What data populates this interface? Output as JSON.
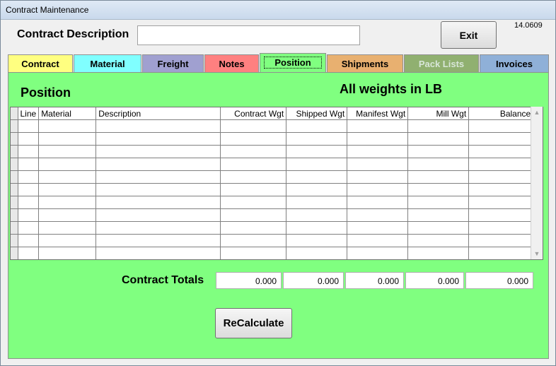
{
  "window": {
    "title": "Contract Maintenance",
    "version": "14.0609"
  },
  "header": {
    "description_label": "Contract Description",
    "description_value": "",
    "exit_label": "Exit"
  },
  "tabs": [
    {
      "label": "Contract",
      "color": "#ffff80"
    },
    {
      "label": "Material",
      "color": "#80ffff"
    },
    {
      "label": "Freight",
      "color": "#a0a0d0"
    },
    {
      "label": "Notes",
      "color": "#ff8080"
    },
    {
      "label": "Position",
      "color": "#80ff80",
      "active": true
    },
    {
      "label": "Shipments",
      "color": "#e8b070"
    },
    {
      "label": "Pack Lists",
      "color": "#90b070",
      "disabled": true
    },
    {
      "label": "Invoices",
      "color": "#8fb0d8"
    }
  ],
  "panel": {
    "title": "Position",
    "note": "All weights in LB",
    "background": "#80ff80"
  },
  "grid": {
    "columns": [
      "Line",
      "Material",
      "Description",
      "Contract Wgt",
      "Shipped Wgt",
      "Manifest Wgt",
      "Mill Wgt",
      "Balance"
    ],
    "rows": [
      [],
      [],
      [],
      [],
      [],
      [],
      [],
      [],
      [],
      [],
      []
    ]
  },
  "totals": {
    "label": "Contract Totals",
    "values": [
      "0.000",
      "0.000",
      "0.000",
      "0.000",
      "0.000"
    ]
  },
  "recalc_label": "ReCalculate"
}
